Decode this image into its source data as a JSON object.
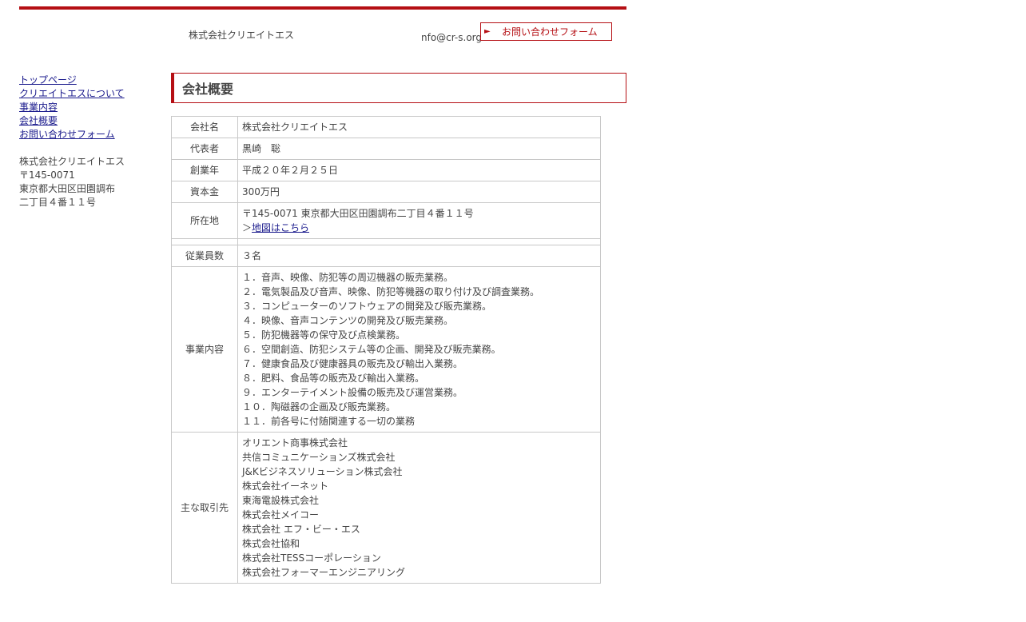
{
  "header": {
    "company": "株式会社クリエイトエス",
    "email": "nfo@cr-s.org",
    "contact_button": "お問い合わせフォーム",
    "contact_arrow": "►"
  },
  "nav": {
    "items": [
      "トップページ",
      "クリエイトエスについて",
      "事業内容",
      "会社概要",
      "お問い合わせフォーム"
    ]
  },
  "address": {
    "lines": [
      "株式会社クリエイトエス",
      "〒145-0071",
      "東京都大田区田園調布",
      "二丁目４番１１号"
    ]
  },
  "section": {
    "title": "会社概要"
  },
  "table": {
    "company_name": {
      "label": "会社名",
      "value": "株式会社クリエイトエス"
    },
    "representative": {
      "label": "代表者",
      "value": "黒崎　聡"
    },
    "founded": {
      "label": "創業年",
      "value": "平成２０年２月２５日"
    },
    "capital": {
      "label": "資本金",
      "value": "300万円"
    },
    "location": {
      "label": "所在地",
      "value": "〒145-0071 東京都大田区田園調布二丁目４番１１号",
      "map_prefix": "＞",
      "map_link": "地図はこちら"
    },
    "employees": {
      "label": "従業員数",
      "value": "３名"
    },
    "business": {
      "label": "事業内容",
      "items": [
        "１．音声、映像、防犯等の周辺機器の販売業務。",
        "２．電気製品及び音声、映像、防犯等機器の取り付け及び調査業務。",
        "３．コンピューターのソフトウェアの開発及び販売業務。",
        "４．映像、音声コンテンツの開発及び販売業務。",
        "５．防犯機器等の保守及び点検業務。",
        "６．空間創造、防犯システム等の企画、開発及び販売業務。",
        "７．健康食品及び健康器具の販売及び輸出入業務。",
        "８．肥料、食品等の販売及び輸出入業務。",
        "９．エンターテイメント設備の販売及び運営業務。",
        "１０．陶磁器の企画及び販売業務。",
        "１１．前各号に付随関連する一切の業務"
      ]
    },
    "clients": {
      "label": "主な取引先",
      "items": [
        "オリエント商事株式会社",
        "共信コミュニケーションズ株式会社",
        "J&Kビジネスソリューション株式会社",
        "株式会社イーネット",
        "東海電設株式会社",
        "株式会社メイコー",
        "株式会社 エフ・ビー・エス",
        "株式会社協和",
        "株式会社TESSコーポレーション",
        "株式会社フォーマーエンジニアリング"
      ]
    }
  },
  "colors": {
    "accent": "#b50f14",
    "link": "#1a1a8c",
    "text": "#444444",
    "border": "#c8c8c8"
  }
}
